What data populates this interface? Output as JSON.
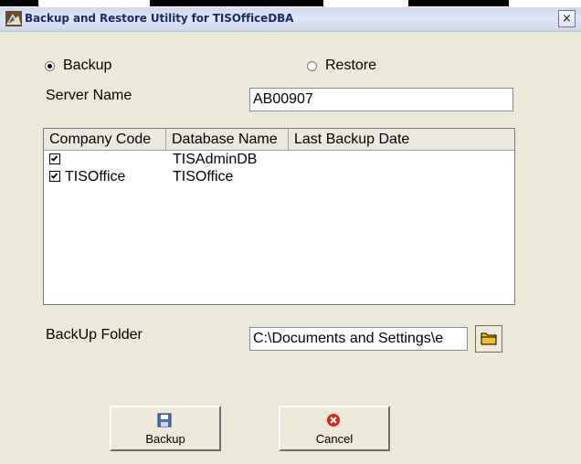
{
  "window": {
    "title": "Backup and Restore Utility for TISOfficeDBA",
    "close_label": "×"
  },
  "mode": {
    "backup_label": "Backup",
    "restore_label": "Restore",
    "selected": "backup"
  },
  "server": {
    "label": "Server Name",
    "value": "AB00907"
  },
  "grid": {
    "columns": [
      "Company Code",
      "Database Name",
      "Last Backup Date"
    ],
    "rows": [
      {
        "checked": true,
        "company_code": "",
        "database_name": "TISAdminDB",
        "last_backup_date": ""
      },
      {
        "checked": true,
        "company_code": "TISOffice",
        "database_name": "TISOffice",
        "last_backup_date": ""
      }
    ]
  },
  "folder": {
    "label": "BackUp Folder",
    "value": "C:\\Documents and Settings\\e"
  },
  "buttons": {
    "backup_label": "Backup",
    "cancel_label": "Cancel"
  },
  "icons": {
    "app": "app-icon",
    "folder": "folder-icon",
    "save": "save-icon",
    "cancel": "cancel-icon"
  },
  "colors": {
    "title_text": "#1b2a6b",
    "dialog_bg": "#ece9d8",
    "cancel_red": "#d0281c",
    "folder_yellow": "#f2c21b"
  }
}
